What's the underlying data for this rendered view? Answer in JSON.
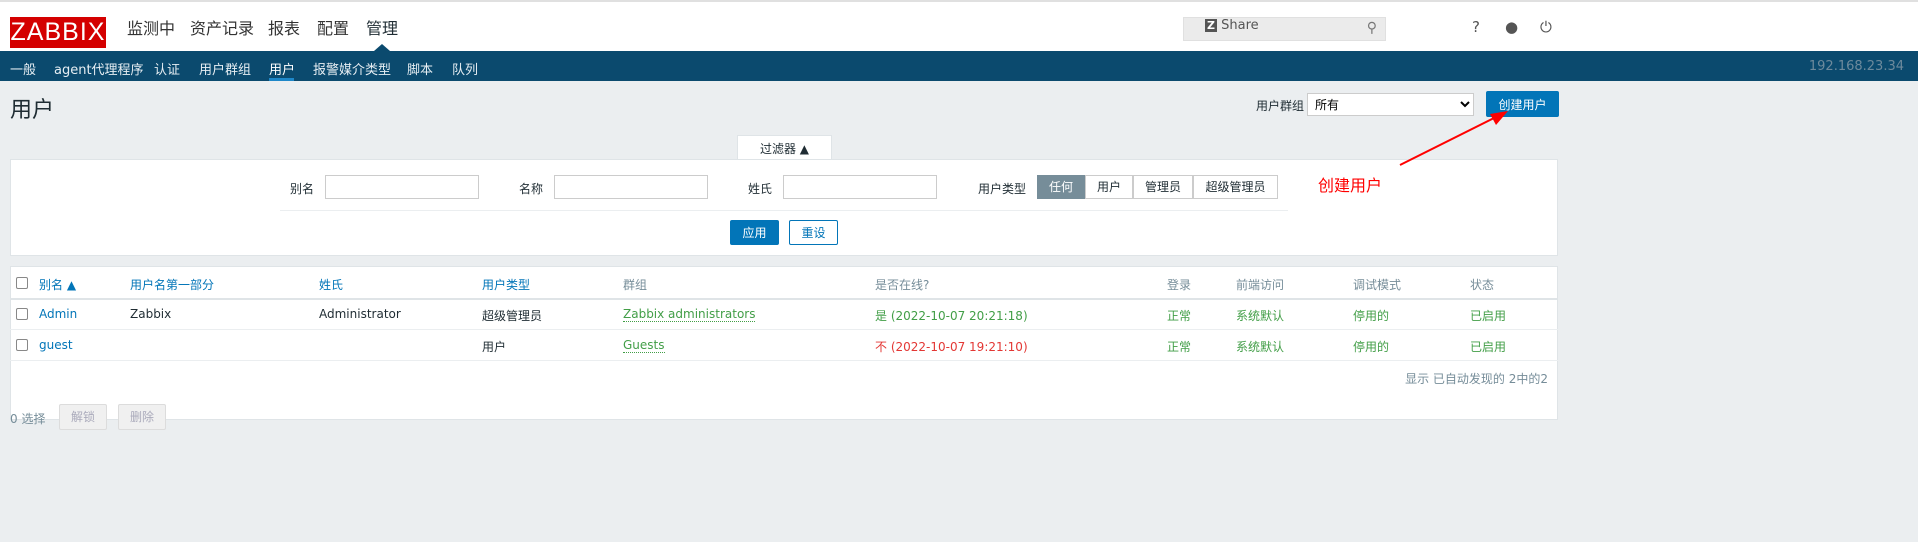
{
  "header": {
    "logo": "ZABBIX",
    "menu": [
      "监测中",
      "资产记录",
      "报表",
      "配置",
      "管理"
    ],
    "active_menu": "管理",
    "search_placeholder": "",
    "share": "Share",
    "help": "?"
  },
  "subnav": {
    "items": [
      "一般",
      "agent代理程序",
      "认证",
      "用户群组",
      "用户",
      "报警媒介类型",
      "脚本",
      "队列"
    ],
    "active": "用户",
    "server_ip": "192.168.23.34"
  },
  "page": {
    "title": "用户",
    "group_label": "用户群组",
    "group_value": "所有",
    "create_button": "创建用户"
  },
  "filter": {
    "tab": "过滤器 ▲",
    "alias_label": "别名",
    "name_label": "名称",
    "surname_label": "姓氏",
    "type_label": "用户类型",
    "type_options": [
      "任何",
      "用户",
      "管理员",
      "超级管理员"
    ],
    "type_selected": "任何",
    "apply": "应用",
    "reset": "重设"
  },
  "table": {
    "headers": [
      "别名 ▲",
      "用户名第一部分",
      "姓氏",
      "用户类型",
      "群组",
      "是否在线?",
      "登录",
      "前端访问",
      "调试模式",
      "状态"
    ],
    "rows": [
      {
        "alias": "Admin",
        "name": "Zabbix",
        "surname": "Administrator",
        "type": "超级管理员",
        "group": "Zabbix administrators",
        "online": "是 (2022-10-07 20:21:18)",
        "online_status": "yes",
        "login": "正常",
        "frontend": "系统默认",
        "debug": "停用的",
        "status": "已启用"
      },
      {
        "alias": "guest",
        "name": "",
        "surname": "",
        "type": "用户",
        "group": "Guests",
        "online": "不 (2022-10-07 19:21:10)",
        "online_status": "no",
        "login": "正常",
        "frontend": "系统默认",
        "debug": "停用的",
        "status": "已启用"
      }
    ],
    "footer": "显示 已自动发现的 2中的2"
  },
  "bottom": {
    "selected": "0 选择",
    "unlock": "解锁",
    "delete": "删除"
  },
  "annotation": {
    "text": "创建用户",
    "color": "#ff0000"
  }
}
